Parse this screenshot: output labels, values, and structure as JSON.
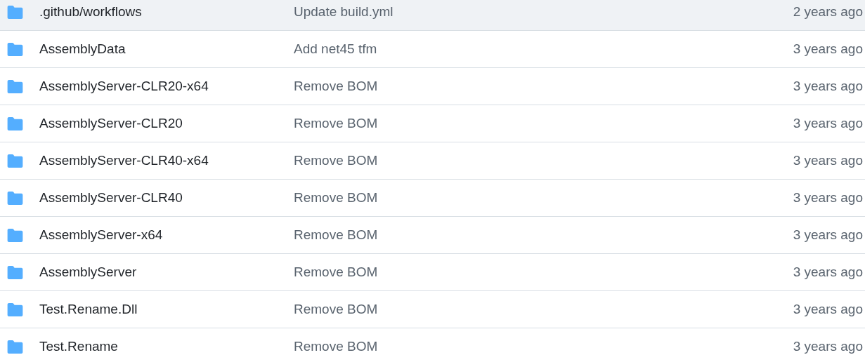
{
  "rows": [
    {
      "name": ".github/workflows",
      "message": "Update build.yml",
      "age": "2 years ago",
      "highlighted": true
    },
    {
      "name": "AssemblyData",
      "message": "Add net45 tfm",
      "age": "3 years ago",
      "highlighted": false
    },
    {
      "name": "AssemblyServer-CLR20-x64",
      "message": "Remove BOM",
      "age": "3 years ago",
      "highlighted": false
    },
    {
      "name": "AssemblyServer-CLR20",
      "message": "Remove BOM",
      "age": "3 years ago",
      "highlighted": false
    },
    {
      "name": "AssemblyServer-CLR40-x64",
      "message": "Remove BOM",
      "age": "3 years ago",
      "highlighted": false
    },
    {
      "name": "AssemblyServer-CLR40",
      "message": "Remove BOM",
      "age": "3 years ago",
      "highlighted": false
    },
    {
      "name": "AssemblyServer-x64",
      "message": "Remove BOM",
      "age": "3 years ago",
      "highlighted": false
    },
    {
      "name": "AssemblyServer",
      "message": "Remove BOM",
      "age": "3 years ago",
      "highlighted": false
    },
    {
      "name": "Test.Rename.Dll",
      "message": "Remove BOM",
      "age": "3 years ago",
      "highlighted": false
    },
    {
      "name": "Test.Rename",
      "message": "Remove BOM",
      "age": "3 years ago",
      "highlighted": false
    }
  ]
}
